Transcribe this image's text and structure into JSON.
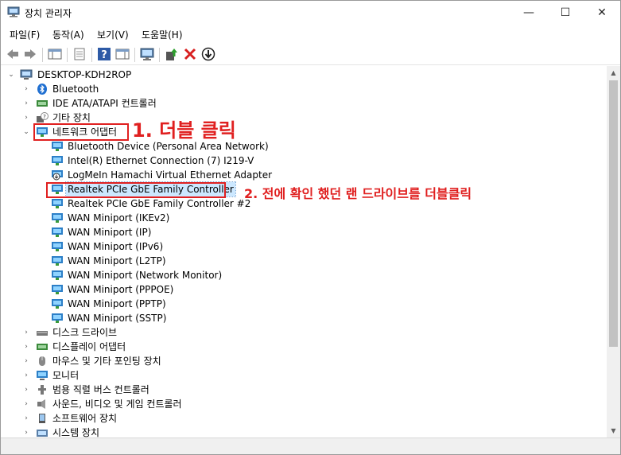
{
  "window": {
    "title": "장치 관리자",
    "minimize": "—",
    "maximize": "☐",
    "close": "✕"
  },
  "menu": [
    {
      "label": "파일(F)"
    },
    {
      "label": "동작(A)"
    },
    {
      "label": "보기(V)"
    },
    {
      "label": "도움말(H)"
    }
  ],
  "tree": {
    "root": "DESKTOP-KDH2ROP",
    "categories": [
      {
        "label": "Bluetooth"
      },
      {
        "label": "IDE ATA/ATAPI 컨트롤러"
      },
      {
        "label": "기타 장치"
      },
      {
        "label": "네트워크 어댑터"
      }
    ],
    "network_adapters": [
      {
        "label": "Bluetooth Device (Personal Area Network)"
      },
      {
        "label": "Intel(R) Ethernet Connection (7) I219-V"
      },
      {
        "label": "LogMeIn Hamachi Virtual Ethernet Adapter"
      },
      {
        "label": "Realtek PCIe GbE Family Controller"
      },
      {
        "label": "Realtek PCIe GbE Family Controller #2"
      },
      {
        "label": "WAN Miniport (IKEv2)"
      },
      {
        "label": "WAN Miniport (IP)"
      },
      {
        "label": "WAN Miniport (IPv6)"
      },
      {
        "label": "WAN Miniport (L2TP)"
      },
      {
        "label": "WAN Miniport (Network Monitor)"
      },
      {
        "label": "WAN Miniport (PPPOE)"
      },
      {
        "label": "WAN Miniport (PPTP)"
      },
      {
        "label": "WAN Miniport (SSTP)"
      }
    ],
    "more_categories": [
      {
        "label": "디스크 드라이브"
      },
      {
        "label": "디스플레이 어댑터"
      },
      {
        "label": "마우스 및 기타 포인팅 장치"
      },
      {
        "label": "모니터"
      },
      {
        "label": "범용 직렬 버스 컨트롤러"
      },
      {
        "label": "사운드, 비디오 및 게임 컨트롤러"
      },
      {
        "label": "소프트웨어 장치"
      },
      {
        "label": "시스템 장치"
      }
    ]
  },
  "annotations": {
    "step1": "1. 더블 클릭",
    "step2": "2. 전에 확인 했던 랜 드라이브를 더블클릭"
  },
  "colors": {
    "annotation": "#e02020",
    "selection": "#cce8ff"
  }
}
